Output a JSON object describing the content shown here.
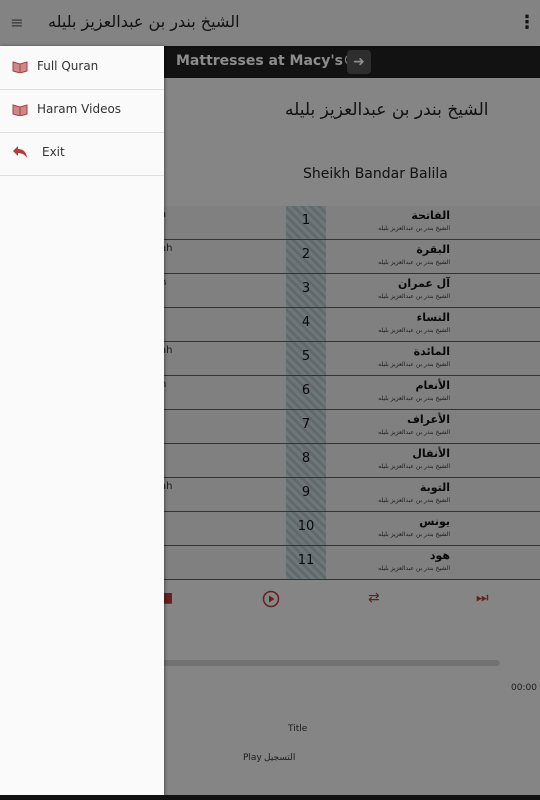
{
  "app_bar": {
    "title": "الشيخ بندر بن عبدالعزيز بليله",
    "menu_icon": "hamburger-icon",
    "overflow_icon": "more-vert-icon"
  },
  "ad": {
    "text": "Mattresses at Macy's®",
    "arrow_icon": "arrow-right-icon"
  },
  "heading": {
    "arabic": "الشيخ بندر بن عبدالعزيز بليله",
    "english": "Sheikh Bandar Balila"
  },
  "tracks": [
    {
      "num": "1",
      "name": "الفاتحة",
      "sub": "الشيخ بندر بن عبدالعزيز بليله",
      "en": "a"
    },
    {
      "num": "2",
      "name": "البقرة",
      "sub": "الشيخ بندر بن عبدالعزيز بليله",
      "en": "ah"
    },
    {
      "num": "3",
      "name": "آل عمران",
      "sub": "الشيخ بندر بن عبدالعزيز بليله",
      "en": "n"
    },
    {
      "num": "4",
      "name": "النساء",
      "sub": "الشيخ بندر بن عبدالعزيز بليله",
      "en": ""
    },
    {
      "num": "5",
      "name": "المائدة",
      "sub": "الشيخ بندر بن عبدالعزيز بليله",
      "en": "ah"
    },
    {
      "num": "6",
      "name": "الأنعام",
      "sub": "الشيخ بندر بن عبدالعزيز بليله",
      "en": "n"
    },
    {
      "num": "7",
      "name": "الأعراف",
      "sub": "الشيخ بندر بن عبدالعزيز بليله",
      "en": "f"
    },
    {
      "num": "8",
      "name": "الأنفال",
      "sub": "الشيخ بندر بن عبدالعزيز بليله",
      "en": "l"
    },
    {
      "num": "9",
      "name": "التوبة",
      "sub": "الشيخ بندر بن عبدالعزيز بليله",
      "en": "ah"
    },
    {
      "num": "10",
      "name": "يونس",
      "sub": "الشيخ بندر بن عبدالعزيز بليله",
      "en": ""
    },
    {
      "num": "11",
      "name": "هود",
      "sub": "الشيخ بندر بن عبدالعزيز بليله",
      "en": ""
    }
  ],
  "player": {
    "time": "00:00",
    "title_label": "Title",
    "play_label": "Play",
    "record_label": "التسجيل",
    "stop_icon": "stop-icon",
    "play_icon": "play-circle-icon",
    "shuffle_icon": "shuffle-icon",
    "next_icon": "fast-forward-icon",
    "progress": 0
  },
  "drawer": {
    "items": [
      {
        "label": "Full Quran",
        "icon": "quran-book-icon"
      },
      {
        "label": "Haram Videos",
        "icon": "quran-book-icon"
      },
      {
        "label": "Exit",
        "icon": "back-arrow-icon"
      }
    ]
  },
  "colors": {
    "accent": "#b73b3b",
    "app_bar": "#eeeeee",
    "ad_bg": "#222222"
  }
}
